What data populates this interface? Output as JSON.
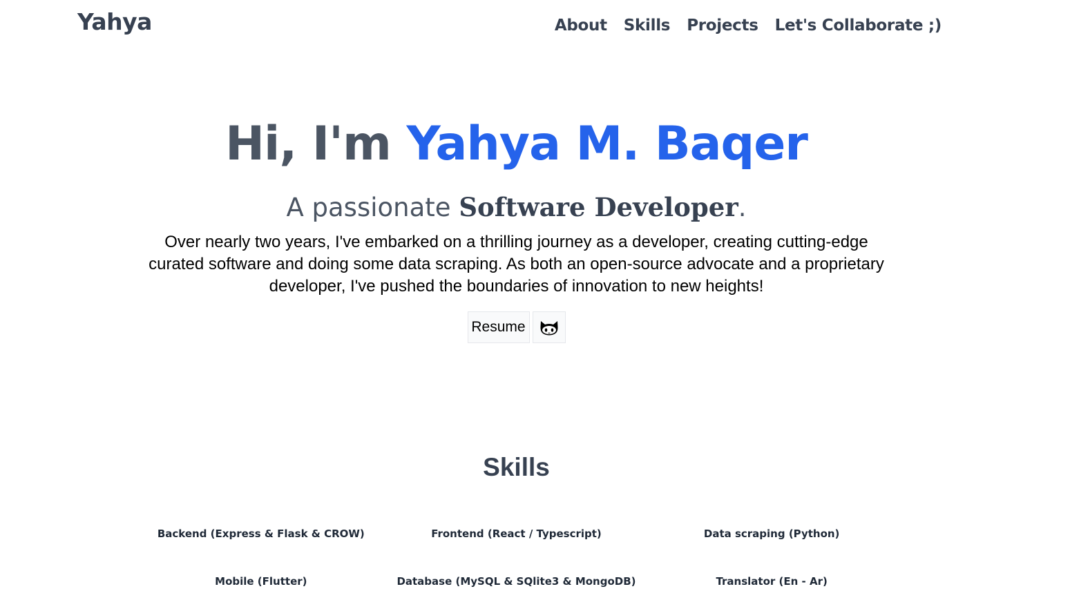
{
  "header": {
    "brand": "Yahya",
    "nav": [
      "About",
      "Skills",
      "Projects",
      "Let's Collaborate ;)"
    ]
  },
  "hero": {
    "greeting": "Hi, I'm",
    "name": "Yahya M. Baqer",
    "subtitle_prefix": "A passionate",
    "role": "Software Developer",
    "subtitle_suffix": ".",
    "intro": "Over nearly two years, I've embarked on a thrilling journey as a developer, creating cutting-edge curated software and doing some data scraping. As both an open-source advocate and a proprietary developer, I've pushed the boundaries of innovation to new heights!",
    "resume_label": "Resume",
    "github_icon": "github-icon"
  },
  "skills": {
    "heading": "Skills",
    "items": [
      "Backend (Express & Flask & CROW)",
      "Frontend (React / Typescript)",
      "Data scraping (Python)",
      "Mobile (Flutter)",
      "Database (MySQL & SQlite3 & MongoDB)",
      "Translator (En - Ar)"
    ]
  },
  "colors": {
    "accent": "#2563eb",
    "text": "#374151"
  }
}
